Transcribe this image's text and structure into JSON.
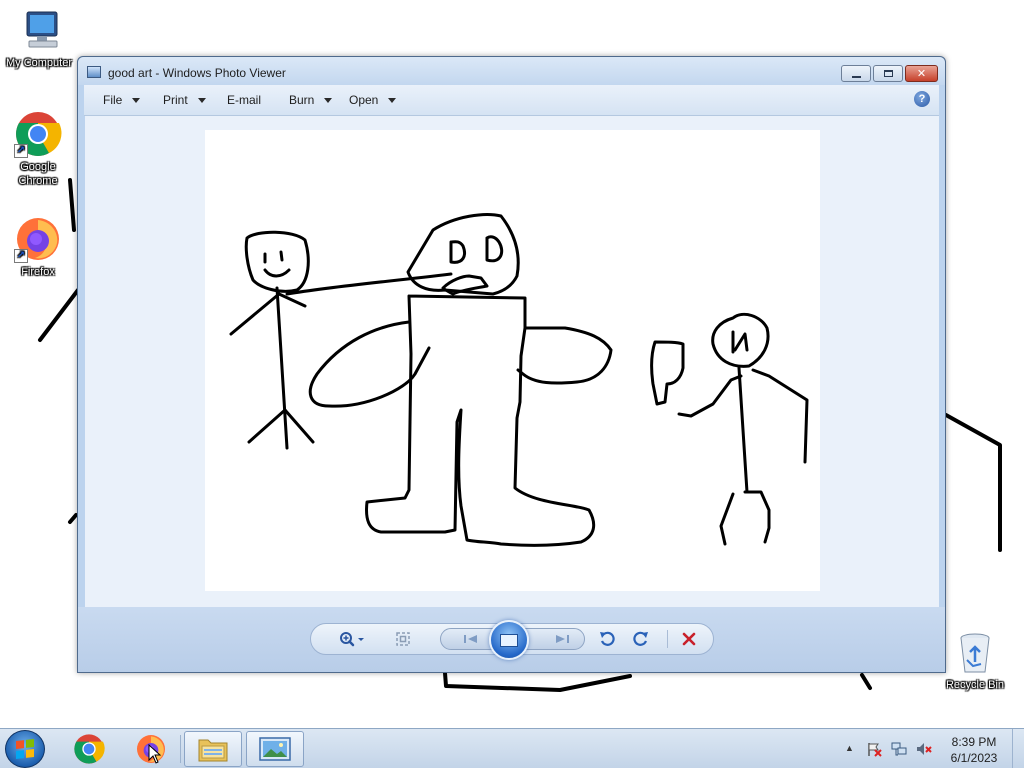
{
  "desktop": {
    "icons": [
      {
        "label": "My Computer",
        "icon": "computer-icon"
      },
      {
        "label": "Google Chrome",
        "label_line1": "Google",
        "label_line2": "Chrome",
        "icon": "chrome-icon"
      },
      {
        "label": "Firefox",
        "icon": "firefox-icon"
      },
      {
        "label": "Recycle Bin",
        "icon": "recycle-bin-icon"
      }
    ]
  },
  "window": {
    "title": "good art - Windows Photo Viewer",
    "caption_buttons": {
      "minimize": "▭",
      "maximize": "◻",
      "close": "✕"
    },
    "menu": [
      {
        "label": "File",
        "has_dropdown": true
      },
      {
        "label": "Print",
        "has_dropdown": true
      },
      {
        "label": "E-mail",
        "has_dropdown": false
      },
      {
        "label": "Burn",
        "has_dropdown": true
      },
      {
        "label": "Open",
        "has_dropdown": true
      }
    ],
    "help_label": "?",
    "image": {
      "description_icon": "drawing-image"
    },
    "controls": {
      "zoom_icon": "zoom-icon",
      "actual_size_icon": "actual-size-icon",
      "previous_icon": "previous-icon",
      "slideshow_icon": "slideshow-icon",
      "next_icon": "next-icon",
      "rotate_left_icon": "rotate-counterclockwise-icon",
      "rotate_right_icon": "rotate-clockwise-icon",
      "delete_icon": "delete-icon"
    }
  },
  "taskbar": {
    "start_icon": "windows-logo-icon",
    "pinned": [
      {
        "name": "Google Chrome",
        "icon": "chrome-icon"
      },
      {
        "name": "Firefox",
        "icon": "firefox-icon"
      },
      {
        "name": "Windows Explorer",
        "icon": "folder-icon"
      },
      {
        "name": "Windows Photo Viewer",
        "icon": "photo-viewer-icon"
      }
    ],
    "tray": {
      "show_hidden_icon": "▲",
      "icons": [
        "action-center-flag-icon",
        "network-icon",
        "volume-muted-icon"
      ],
      "time": "8:39 PM",
      "date": "6/1/2023"
    }
  },
  "colors": {
    "window_frame": "#bcd3ee",
    "viewer_background": "#eaf1fa",
    "taskbar": "#c3d4e8",
    "delete_red": "#c8202a"
  }
}
